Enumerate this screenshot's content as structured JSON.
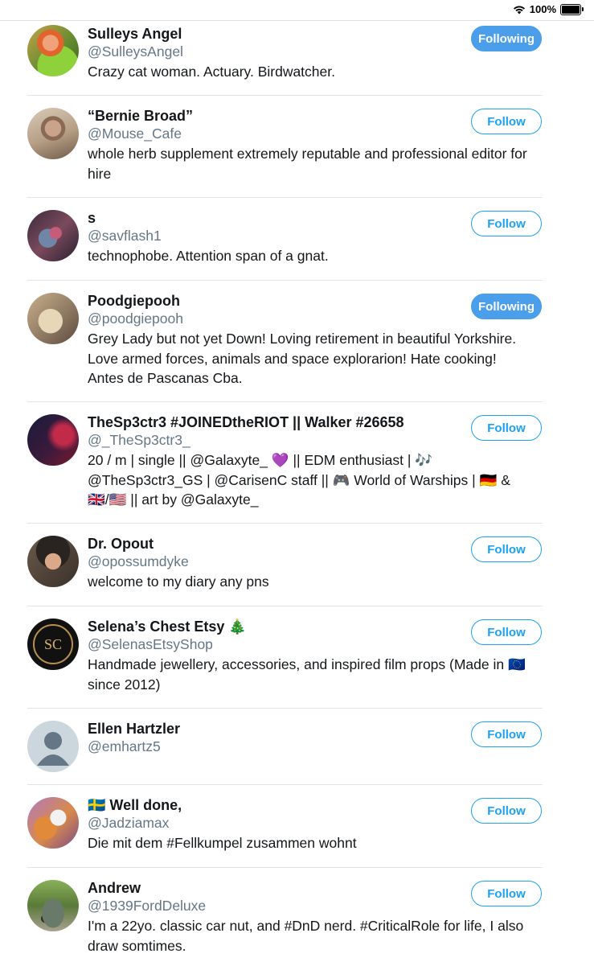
{
  "status_bar": {
    "battery_text": "100%"
  },
  "users": [
    {
      "name": "Sulleys Angel",
      "handle": "@SulleysAngel",
      "bio": [
        "Crazy cat woman. Actuary. Birdwatcher."
      ],
      "button": "Following"
    },
    {
      "name": "“Bernie Broad”",
      "handle": "@Mouse_Cafe",
      "bio": [
        "whole herb supplement extremely reputable and professional editor for",
        "hire"
      ],
      "button": "Follow"
    },
    {
      "name": "s",
      "handle": "@savflash1",
      "bio": [
        "technophobe. Attention span of a gnat."
      ],
      "button": "Follow"
    },
    {
      "name": "Poodgiepooh",
      "handle": "@poodgiepooh",
      "bio": [
        "Grey Lady but not yet Down! Loving retirement in beautiful Yorkshire.",
        "Love armed forces, animals and space explorarion! Hate cooking!",
        "Antes de Pascanas Cba."
      ],
      "button": "Following"
    },
    {
      "name": "TheSp3ctr3 #JOINEDtheRIOT || Walker #26658",
      "handle": "@_TheSp3ctr3_",
      "bio": [
        "20 / m | single || @Galaxyte_ 💜 || EDM enthusiast | 🎶",
        "@TheSp3ctr3_GS | @CarisenC staff || 🎮 World of Warships | 🇩🇪 &",
        "🇬🇧/🇺🇸 || art by @Galaxyte_"
      ],
      "button": "Follow"
    },
    {
      "name": "Dr. Opout",
      "handle": "@opossumdyke",
      "bio": [
        "welcome to my diary any pns"
      ],
      "button": "Follow"
    },
    {
      "name": "Selena’s Chest Etsy 🎄",
      "handle": "@SelenasEtsyShop",
      "bio": [
        "Handmade jewellery, accessories, and inspired film props (Made in 🇪🇺",
        "since 2012)"
      ],
      "button": "Follow",
      "avatar_text": "SC"
    },
    {
      "name": "Ellen Hartzler",
      "handle": "@emhartz5",
      "bio": [],
      "button": "Follow"
    },
    {
      "name": "🇸🇪 Well done,",
      "handle": "@Jadziamax",
      "bio": [
        "Die mit dem #Fellkumpel zusammen wohnt"
      ],
      "button": "Follow"
    },
    {
      "name": "Andrew",
      "handle": "@1939FordDeluxe",
      "bio": [
        "I'm a 22yo. classic car nut, and #DnD nerd. #CriticalRole for life, I also",
        "draw somtimes."
      ],
      "button": "Follow"
    }
  ],
  "colors": {
    "accent": "#1da1f2",
    "following_bg": "#4a9eea",
    "handle": "#657786",
    "separator": "#e1e4e6"
  }
}
